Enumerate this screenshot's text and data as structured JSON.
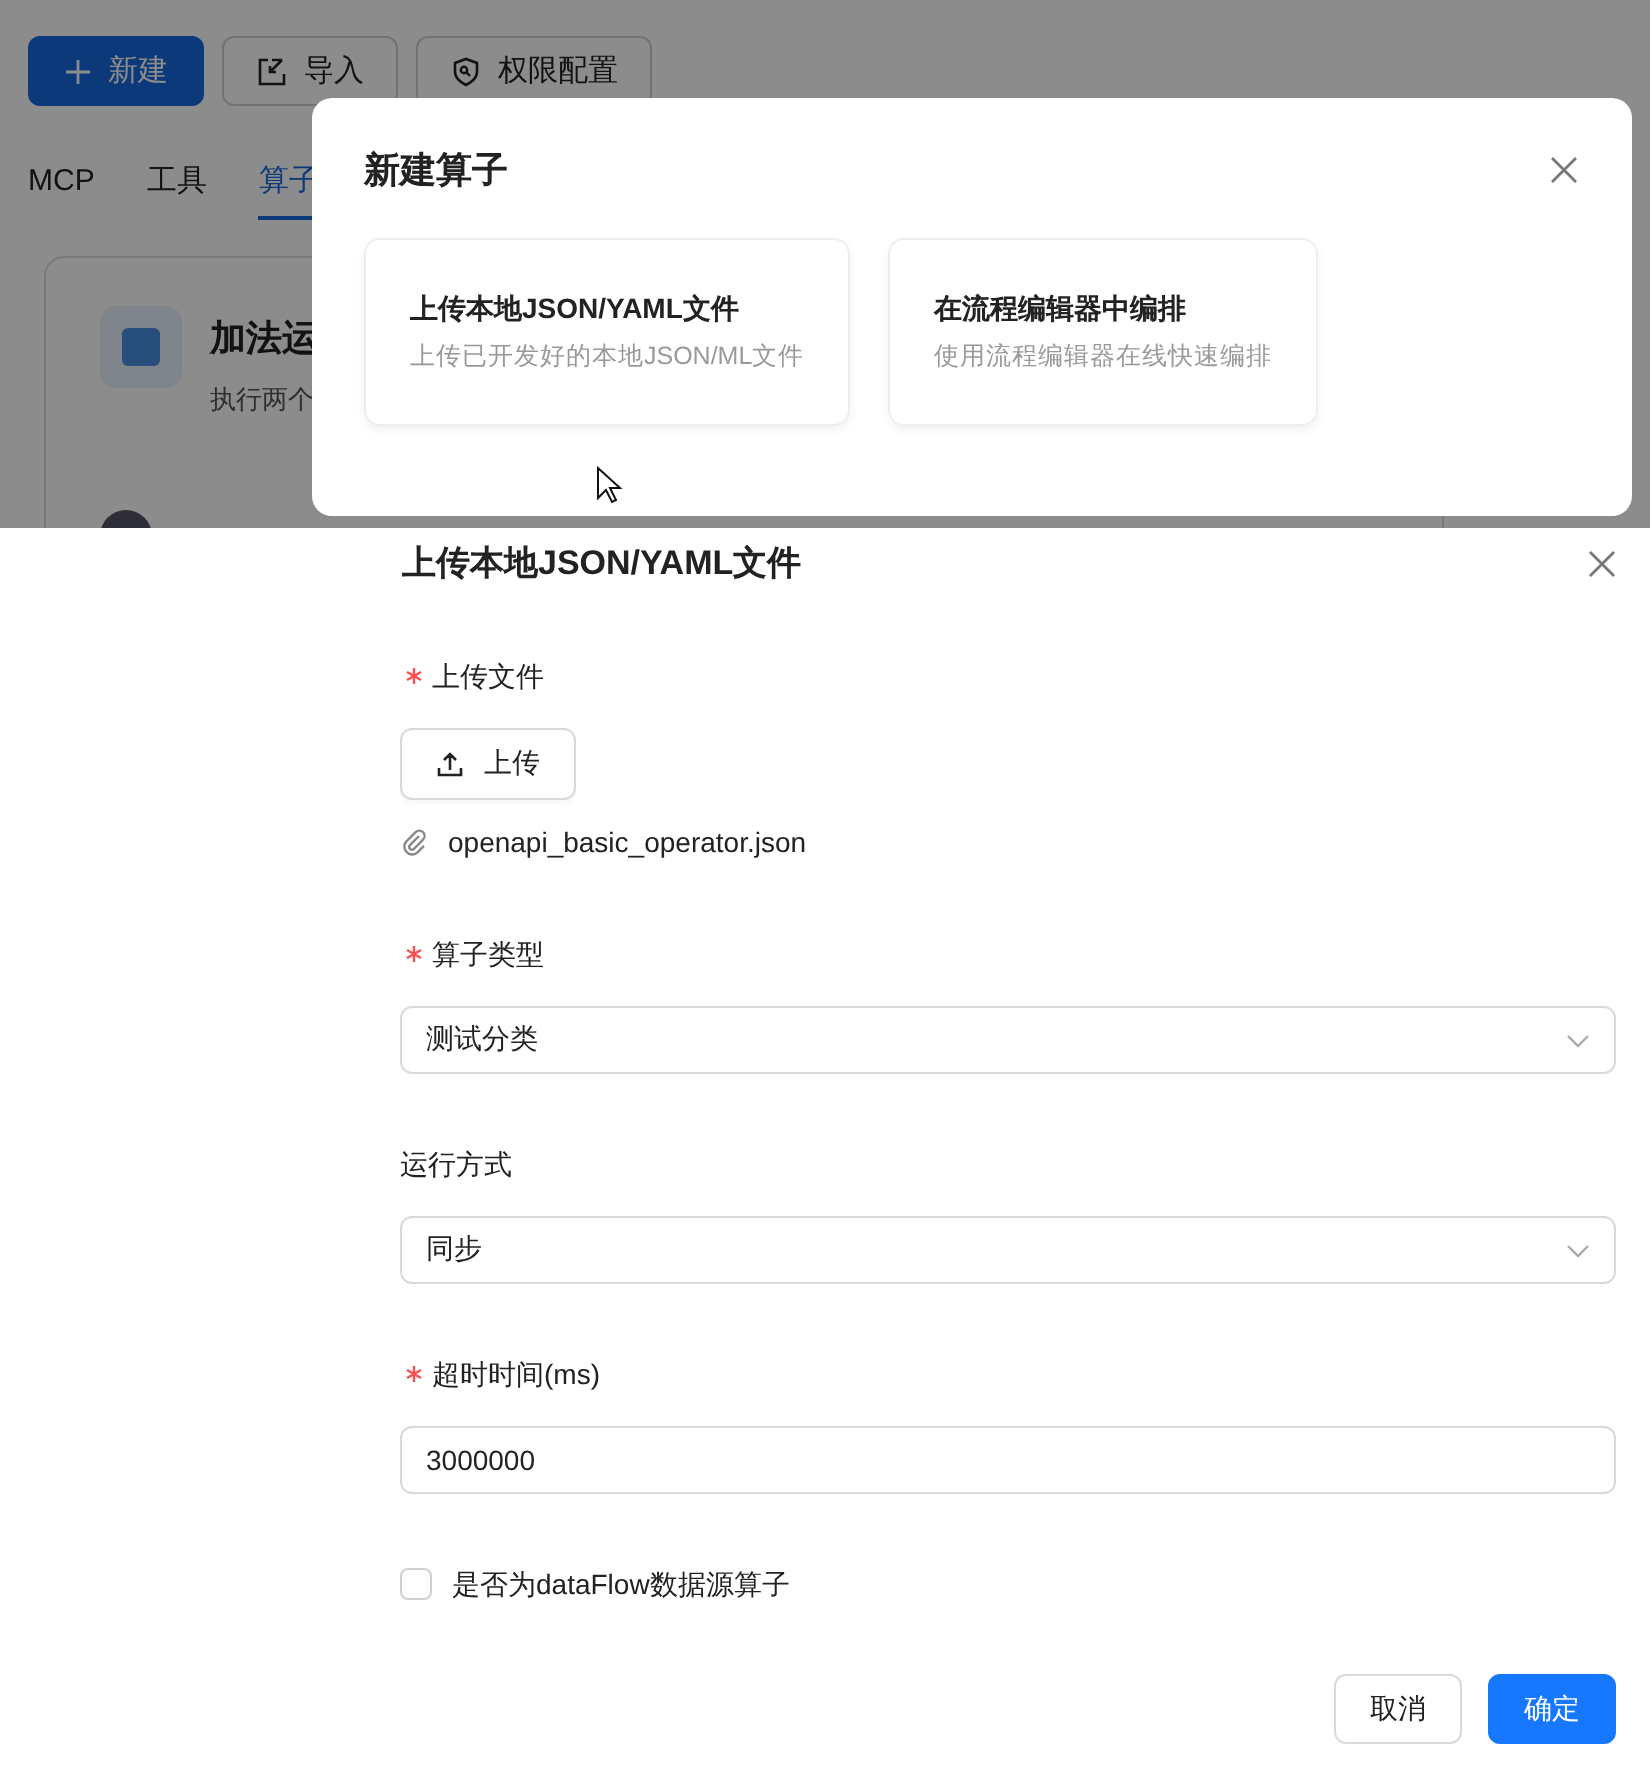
{
  "page": {
    "toolbar": [
      {
        "label": "新建",
        "kind": "primary"
      },
      {
        "label": "导入",
        "kind": "import"
      },
      {
        "label": "权限配置",
        "kind": "permission"
      }
    ],
    "tabs": [
      {
        "label": "MCP",
        "selected": false
      },
      {
        "label": "工具",
        "selected": false
      },
      {
        "label": "算子",
        "selected": true
      }
    ],
    "card": {
      "title": "加法运",
      "description": "执行两个"
    }
  },
  "dialog": {
    "title": "新建算子",
    "options": [
      {
        "title": "上传本地JSON/YAML文件",
        "description": "上传已开发好的本地JSON/ML文件"
      },
      {
        "title": "在流程编辑器中编排",
        "description": "使用流程编辑器在线快速编排"
      }
    ]
  },
  "form": {
    "title": "上传本地JSON/YAML文件",
    "fields": [
      {
        "kind": "upload",
        "label": "上传文件",
        "required": true,
        "button": "上传",
        "file": "openapi_basic_operator.json"
      },
      {
        "kind": "select",
        "label": "算子类型",
        "required": true,
        "value": "测试分类"
      },
      {
        "kind": "select",
        "label": "运行方式",
        "required": false,
        "value": "同步"
      },
      {
        "kind": "input",
        "label": "超时时间(ms)",
        "required": true,
        "value": "3000000"
      },
      {
        "kind": "checkbox",
        "label": "是否为dataFlow数据源算子",
        "checked": false
      }
    ],
    "buttons": [
      {
        "label": "取消",
        "kind": "default"
      },
      {
        "label": "确定",
        "kind": "primary"
      }
    ]
  }
}
